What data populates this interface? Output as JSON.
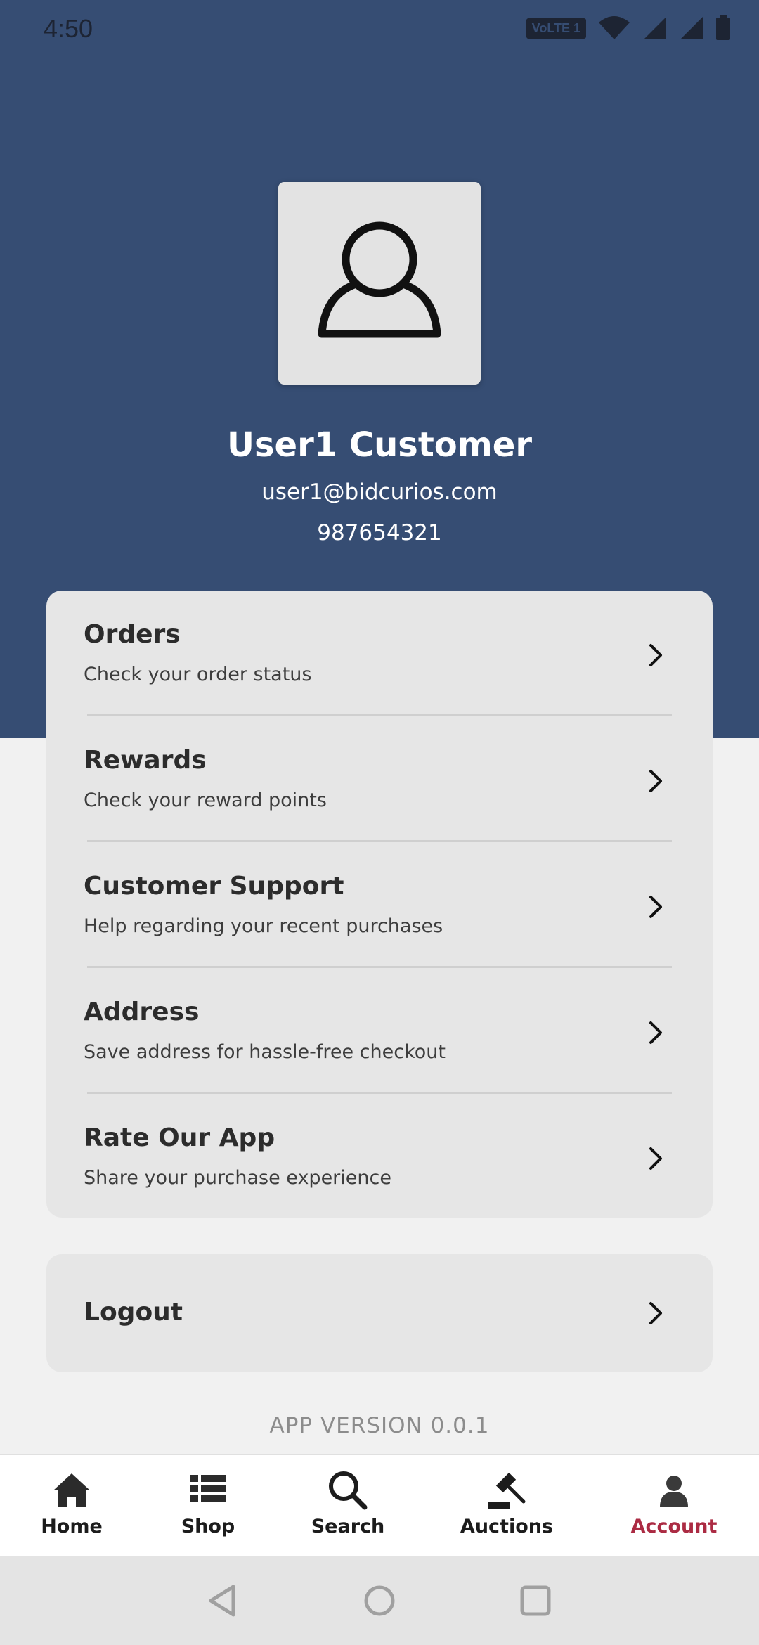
{
  "status_bar": {
    "time": "4:50",
    "volte_label": "VoLTE 1"
  },
  "profile": {
    "name": "User1 Customer",
    "email": "user1@bidcurios.com",
    "phone": "987654321"
  },
  "menu": {
    "items": [
      {
        "title": "Orders",
        "subtitle": "Check your order status"
      },
      {
        "title": "Rewards",
        "subtitle": "Check your reward points"
      },
      {
        "title": "Customer Support",
        "subtitle": "Help regarding your recent purchases"
      },
      {
        "title": "Address",
        "subtitle": "Save address for hassle-free checkout"
      },
      {
        "title": "Rate Our App",
        "subtitle": "Share your purchase experience"
      }
    ]
  },
  "logout": {
    "label": "Logout"
  },
  "app_version": "APP VERSION 0.0.1",
  "bottom_nav": {
    "items": [
      {
        "label": "Home",
        "icon": "home-icon"
      },
      {
        "label": "Shop",
        "icon": "list-icon"
      },
      {
        "label": "Search",
        "icon": "search-icon"
      },
      {
        "label": "Auctions",
        "icon": "gavel-icon"
      },
      {
        "label": "Account",
        "icon": "person-icon",
        "active": true
      }
    ]
  },
  "colors": {
    "header_bg": "#364d73",
    "active_nav": "#ab2b43",
    "card_bg": "#e6e6e6",
    "page_bg": "#f1f1f1"
  }
}
